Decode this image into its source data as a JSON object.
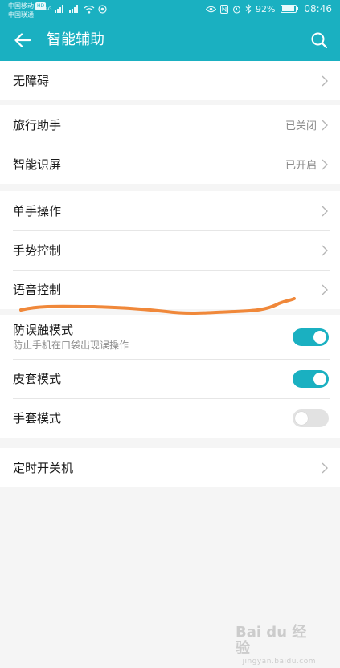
{
  "status_bar": {
    "carrier_1": "中国移动",
    "carrier_1_badge": "HD",
    "carrier_2": "中国联通",
    "network_type": "4G",
    "battery_percent": "92%",
    "battery_level": 0.92,
    "time": "08:46"
  },
  "app_bar": {
    "title": "智能辅助",
    "back_icon": "arrow-left-icon",
    "search_icon": "search-icon"
  },
  "groups": [
    {
      "items": [
        {
          "label": "无障碍"
        }
      ]
    },
    {
      "items": [
        {
          "label": "旅行助手",
          "value": "已关闭"
        },
        {
          "label": "智能识屏",
          "value": "已开启"
        }
      ]
    },
    {
      "items": [
        {
          "label": "单手操作"
        },
        {
          "label": "手势控制"
        },
        {
          "label": "语音控制"
        }
      ]
    },
    {
      "items": [
        {
          "label": "防误触模式",
          "subtitle": "防止手机在口袋出现误操作",
          "toggle": true
        },
        {
          "label": "皮套模式",
          "toggle": true
        },
        {
          "label": "手套模式",
          "toggle": false
        }
      ]
    },
    {
      "items": [
        {
          "label": "定时开关机"
        }
      ]
    }
  ],
  "watermark": {
    "brand": "Bai du 经验",
    "url": "jingyan.baidu.com"
  },
  "colors": {
    "accent": "#1ab0c1",
    "background": "#f5f5f5",
    "annotation": "#f0883a",
    "switch_off": "#e2e2e2"
  }
}
